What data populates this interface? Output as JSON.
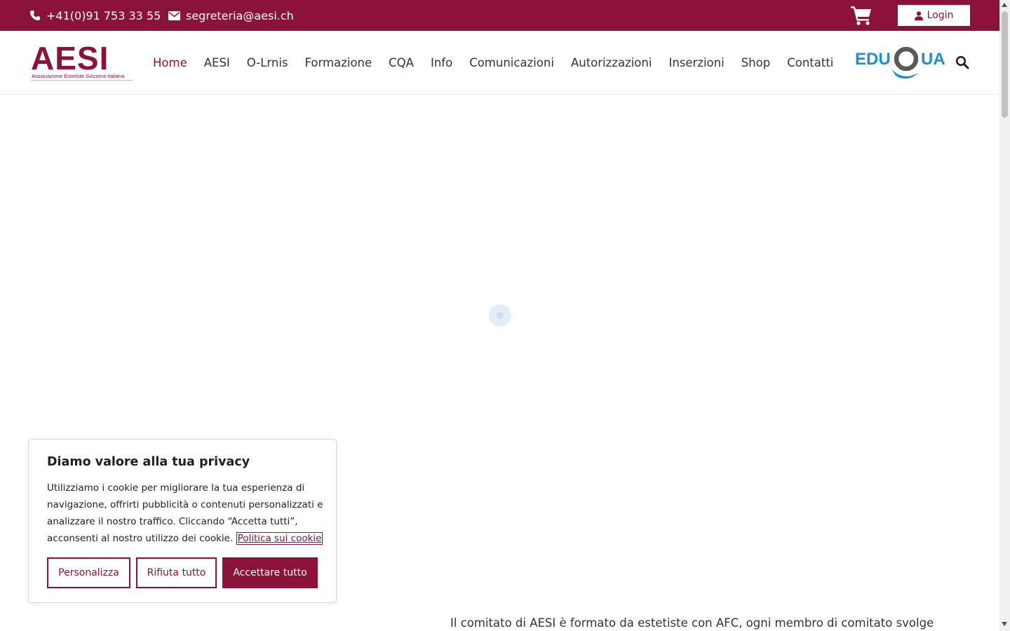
{
  "topbar": {
    "phone": "+41(0)91 753 33 55",
    "email": "segreteria@aesi.ch",
    "login_label": "Login",
    "phone_icon": "phone-icon",
    "email_icon": "envelope-icon",
    "cart_icon": "shopping-cart-icon",
    "user_icon": "user-icon"
  },
  "header": {
    "logo_text": "AESI",
    "logo_subtitle": "Associazione Estetiste Svizzera Italiana",
    "partner_logo_text": "EDUQUA",
    "search_icon": "search-icon",
    "nav": [
      {
        "label": "Home",
        "active": true
      },
      {
        "label": "AESI",
        "active": false
      },
      {
        "label": "O-Lrnis",
        "active": false
      },
      {
        "label": "Formazione",
        "active": false
      },
      {
        "label": "CQA",
        "active": false
      },
      {
        "label": "Info",
        "active": false
      },
      {
        "label": "Comunicazioni",
        "active": false
      },
      {
        "label": "Autorizzazioni",
        "active": false
      },
      {
        "label": "Inserzioni",
        "active": false
      },
      {
        "label": "Shop",
        "active": false
      },
      {
        "label": "Contatti",
        "active": false
      }
    ]
  },
  "main": {
    "intro_text": "Il comitato di AESI è formato da estetiste con AFC, ogni membro di comitato svolge"
  },
  "cookie_banner": {
    "title": "Diamo valore alla tua privacy",
    "text": "Utilizziamo i cookie per migliorare la tua esperienza di navigazione, offrirti pubblicità o contenuti personalizzati e analizzare il nostro traffico. Cliccando “Accetta tutti”, acconsenti al nostro utilizzo dei cookie.",
    "policy_link": "Politica sui cookie",
    "buttons": {
      "customize": "Personalizza",
      "reject": "Rifiuta tutto",
      "accept": "Accettare tutto"
    }
  },
  "colors": {
    "brand": "#8b1238",
    "eduqua_blue": "#1a8fd1"
  }
}
